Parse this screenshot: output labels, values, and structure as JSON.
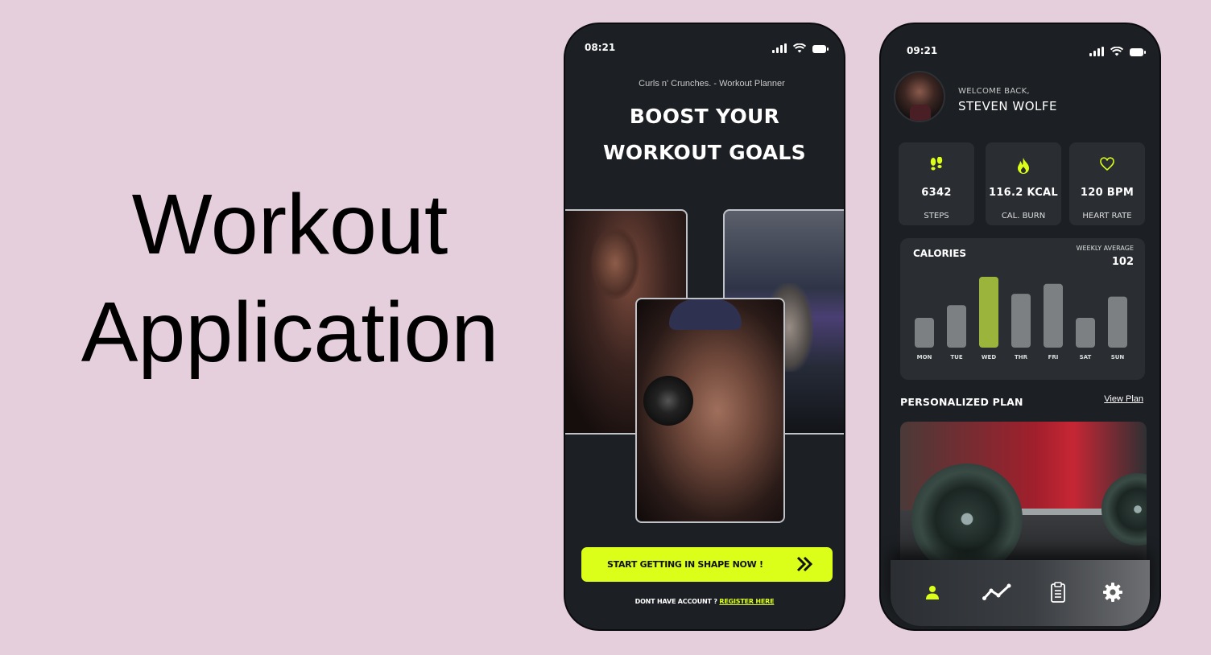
{
  "headline": [
    "Workout",
    "Application"
  ],
  "left_phone": {
    "time": "08:21",
    "subtitle": "Curls n' Crunches. - Workout Planner",
    "title_line1": "BOOST YOUR",
    "title_line2": "WORKOUT GOALS",
    "cta_label": "START GETTING IN SHAPE NOW !",
    "register_prompt": "DONT HAVE ACCOUNT ? ",
    "register_link": "REGISTER HERE"
  },
  "right_phone": {
    "time": "09:21",
    "welcome": "WELCOME BACK,",
    "username": "STEVEN WOLFE",
    "stats": [
      {
        "value": "6342",
        "label": "STEPS",
        "icon": "footsteps-icon"
      },
      {
        "value": "116.2 KCAL",
        "label": "CAL. BURN",
        "icon": "flame-icon"
      },
      {
        "value": "120 BPM",
        "label": "HEART RATE",
        "icon": "heart-icon"
      }
    ],
    "calories": {
      "title": "CALORIES",
      "weekly_label": "WEEKLY AVERAGE",
      "weekly_value": "102",
      "days": [
        "MON",
        "TUE",
        "WED",
        "THR",
        "FRI",
        "SAT",
        "SUN"
      ],
      "levels": [
        0.42,
        0.6,
        1.0,
        0.76,
        0.9,
        0.42,
        0.72
      ],
      "highlight_index": 2
    },
    "plan_title": "PERSONALIZED PLAN",
    "view_plan": "View Plan",
    "nav": [
      "profile-icon",
      "activity-icon",
      "clipboard-icon",
      "settings-icon"
    ]
  },
  "colors": {
    "background": "#e6cfdd",
    "phone": "#1c1f23",
    "card": "#2a2e33",
    "accent": "#dcff1a",
    "bar_highlight": "#9bb53c",
    "bar": "#7d8083"
  }
}
